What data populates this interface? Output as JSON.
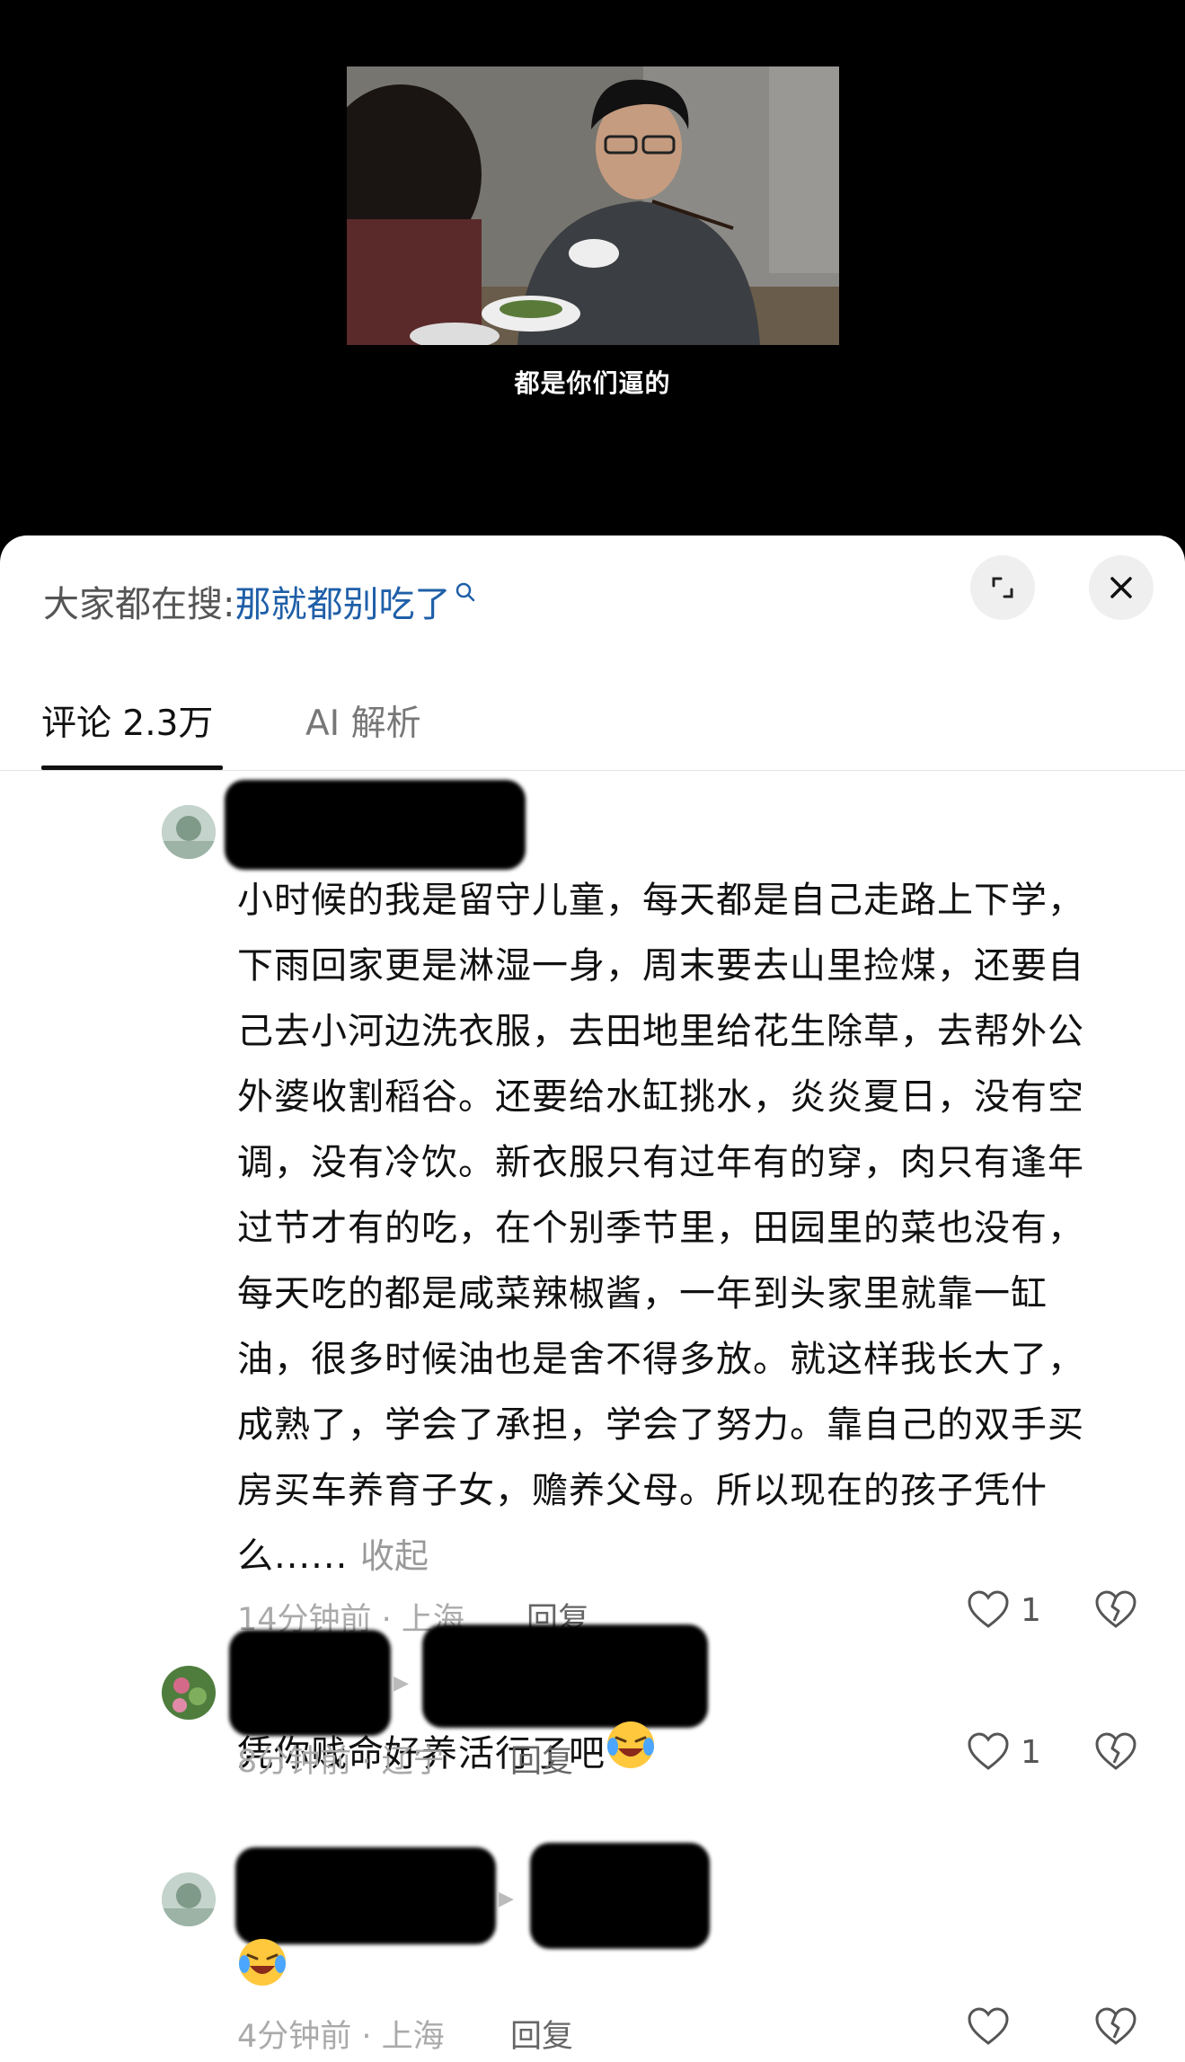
{
  "video": {
    "subtitle": "都是你们逼的"
  },
  "header": {
    "search_label": "大家都在搜:",
    "search_term": "那就都别吃了"
  },
  "tabs": [
    {
      "label": "评论 2.3万",
      "active": true
    },
    {
      "label": "AI 解析",
      "active": false
    }
  ],
  "comments": [
    {
      "text": "小时候的我是留守儿童，每天都是自己走路上下学，下雨回家更是淋湿一身，周末要去山里捡煤，还要自己去小河边洗衣服，去田地里给花生除草，去帮外公外婆收割稻谷。还要给水缸挑水，炎炎夏日，没有空调，没有冷饮。新衣服只有过年有的穿，肉只有逢年过节才有的吃，在个别季节里，田园里的菜也没有，每天吃的都是咸菜辣椒酱，一年到头家里就靠一缸油，很多时候油也是舍不得多放。就这样我长大了，成熟了，学会了承担，学会了努力。靠自己的双手买房买车养育子女，赡养父母。所以现在的孩子凭什么......",
      "collapse": "收起",
      "meta": "14分钟前 · 上海",
      "reply": "回复",
      "likes": "1"
    },
    {
      "text": "凭你贱命好养活行了吧",
      "meta": "8分钟前 · 辽宁",
      "reply": "回复",
      "likes": "1"
    },
    {
      "text": "",
      "meta": "4分钟前 · 上海",
      "reply": "回复",
      "likes": ""
    }
  ],
  "icons": {
    "search": "search-icon",
    "expand": "expand-icon",
    "close": "close-icon",
    "like": "heart-icon",
    "dislike": "broken-heart-icon",
    "emoji": "laughing-crying-emoji-icon"
  },
  "colors": {
    "search_term": "#1f5fa8",
    "meta": "#aaaaaa",
    "background_top": "#000000"
  }
}
